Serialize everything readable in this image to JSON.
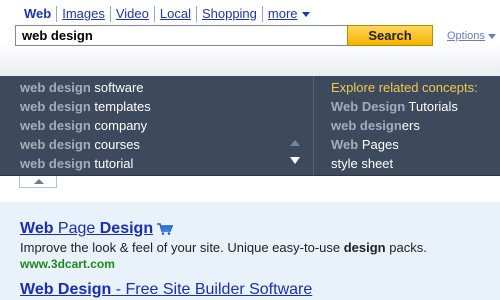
{
  "tabs": [
    {
      "label": "Web",
      "active": true
    },
    {
      "label": "Images"
    },
    {
      "label": "Video"
    },
    {
      "label": "Local"
    },
    {
      "label": "Shopping"
    },
    {
      "label": "more"
    }
  ],
  "search": {
    "value": "web design",
    "button_label": "Search",
    "options_label": "Options"
  },
  "suggestions": [
    {
      "bold": "web design",
      "rest": " software"
    },
    {
      "bold": "web design",
      "rest": " templates"
    },
    {
      "bold": "web design",
      "rest": " company"
    },
    {
      "bold": "web design",
      "rest": " courses"
    },
    {
      "bold": "web design",
      "rest": " tutorial"
    }
  ],
  "related": {
    "heading": "Explore related concepts:",
    "items": [
      {
        "bold": "Web Design",
        "rest": " Tutorials"
      },
      {
        "bold": "web design",
        "rest": "ers"
      },
      {
        "bold": "Web",
        "rest": " Pages"
      },
      {
        "bold": "",
        "rest": "style sheet"
      }
    ]
  },
  "results": [
    {
      "title_bold_1": "Web",
      "title_plain": " Page ",
      "title_bold_2": "Design",
      "desc_pre": "Improve the look & feel of your site. Unique easy-to-use ",
      "desc_bold": "design",
      "desc_post": " packs.",
      "url": "www.3dcart.com"
    },
    {
      "title_bold": "Web Design",
      "title_rest": " - Free Site Builder Software"
    }
  ],
  "colors": {
    "dropdown_bg": "#3d4a5d",
    "search_button": "#f4b200",
    "link": "#1a2fb0",
    "url_green": "#1b8a1b",
    "related_heading": "#f2c94c"
  }
}
